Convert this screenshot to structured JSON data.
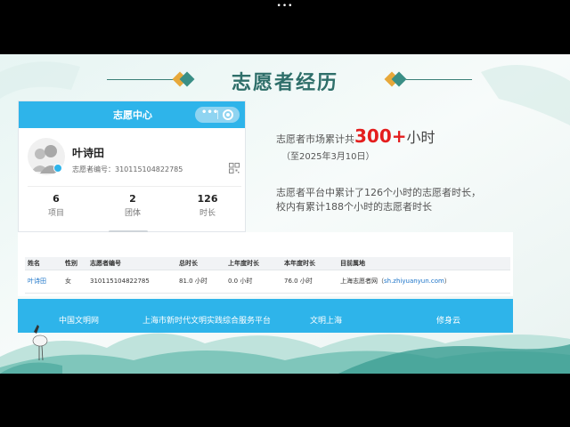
{
  "top_indicator": "•••",
  "slide": {
    "title": "志愿者经历"
  },
  "phone": {
    "header_title": "志愿中心",
    "capsule_more": "•••",
    "user": {
      "name": "叶诗田",
      "id_label": "志愿者编号：",
      "id_value": "310115104822785"
    },
    "stats": [
      {
        "value": "6",
        "label": "项目"
      },
      {
        "value": "2",
        "label": "团体"
      },
      {
        "value": "126",
        "label": "时长"
      }
    ]
  },
  "right_text": {
    "line1_prefix": "志愿者市场累计共",
    "line1_value": "300+",
    "line1_unit": "小时",
    "line2": "（至2025年3月10日）",
    "desc_line1": "志愿者平台中累计了126个小时的志愿者时长，",
    "desc_line2": "校内有累计188个小时的志愿者时长"
  },
  "table": {
    "headers": [
      "姓名",
      "性别",
      "志愿者编号",
      "总时长",
      "上年度时长",
      "本年度时长",
      "目前属地"
    ],
    "rows": [
      {
        "name": "叶诗田",
        "gender": "女",
        "id": "310115104822785",
        "total": "81.0 小时",
        "last_year": "0.0 小时",
        "this_year": "76.0 小时",
        "location_prefix": "上海志愿者网（",
        "location_site": "sh.zhiyuanyun.com",
        "location_suffix": "）"
      }
    ]
  },
  "footer_nav": [
    "中国文明网",
    "上海市新时代文明实践综合服务平台",
    "文明上海",
    "修身云"
  ],
  "colors": {
    "accent": "#2eb4ea",
    "highlight": "#e41e1e",
    "title": "#2f6f6a"
  }
}
